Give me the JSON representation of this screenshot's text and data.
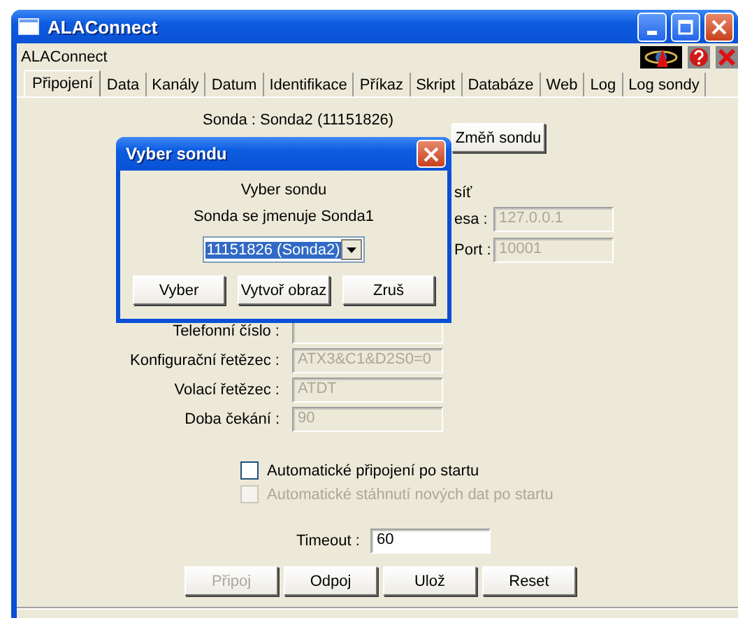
{
  "window": {
    "title": "ALAConnect",
    "header": "ALAConnect"
  },
  "tabs": [
    {
      "label": "Připojení",
      "selected": true
    },
    {
      "label": "Data",
      "selected": false
    },
    {
      "label": "Kanály",
      "selected": false
    },
    {
      "label": "Datum",
      "selected": false
    },
    {
      "label": "Identifikace",
      "selected": false
    },
    {
      "label": "Příkaz",
      "selected": false
    },
    {
      "label": "Skript",
      "selected": false
    },
    {
      "label": "Databáze",
      "selected": false
    },
    {
      "label": "Web",
      "selected": false
    },
    {
      "label": "Log",
      "selected": false
    },
    {
      "label": "Log sondy",
      "selected": false
    }
  ],
  "probe": {
    "label": "Sonda : Sonda2 (11151826)",
    "button": "Změň sondu"
  },
  "network": {
    "title": "síť",
    "fields": [
      {
        "label": "esa :",
        "value": "127.0.0.1",
        "disabled": true
      },
      {
        "label": "Port :",
        "value": "10001",
        "disabled": true
      }
    ]
  },
  "modem_fields": [
    {
      "label": "Telefonní číslo :",
      "disabled": true
    },
    {
      "label": "Konfigurační řetězec :",
      "value": "ATX3&C1&D2S0=0",
      "disabled": true
    },
    {
      "label": "Volací řetězec :",
      "value": "ATDT",
      "disabled": true
    },
    {
      "label": "Doba čekání :",
      "value": "90",
      "disabled": true
    }
  ],
  "checkboxes": [
    {
      "label": "Automatické připojení po startu",
      "checked": false,
      "disabled": false
    },
    {
      "label": "Automatické stáhnutí nových dat po startu",
      "checked": false,
      "disabled": true
    }
  ],
  "timeout": {
    "label": "Timeout :",
    "value": "60"
  },
  "buttons": [
    {
      "label": "Připoj",
      "disabled": true
    },
    {
      "label": "Odpoj",
      "disabled": false
    },
    {
      "label": "Ulož",
      "disabled": false
    },
    {
      "label": "Reset",
      "disabled": false
    }
  ],
  "dialog": {
    "title": "Vyber sondu",
    "heading": "Vyber sondu",
    "message": "Sonda se jmenuje Sonda1",
    "select": {
      "value": "11151826 (Sonda2)"
    },
    "buttons": [
      "Vyber",
      "Vytvoř obraz",
      "Zruš"
    ]
  }
}
